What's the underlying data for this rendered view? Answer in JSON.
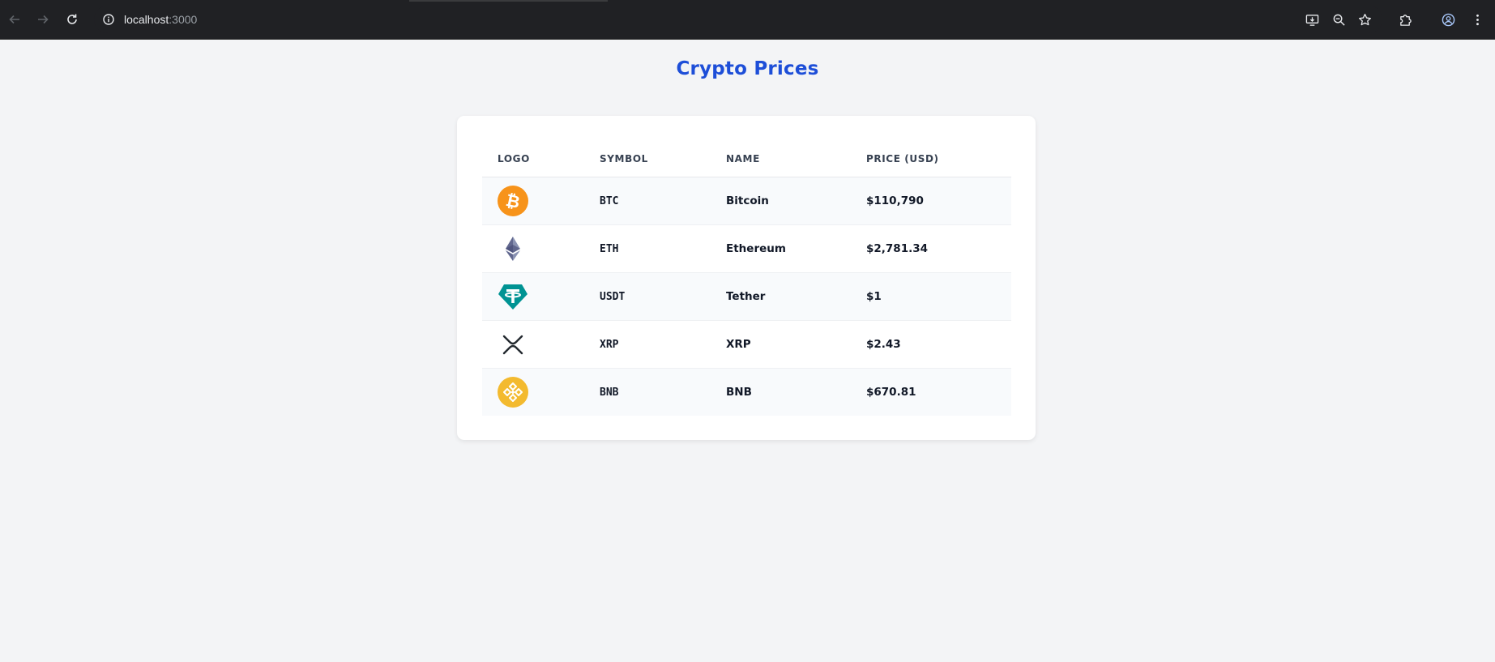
{
  "browser": {
    "url_host": "localhost",
    "url_port": ":3000"
  },
  "page": {
    "title": "Crypto Prices"
  },
  "table": {
    "headers": {
      "logo": "LOGO",
      "symbol": "SYMBOL",
      "name": "NAME",
      "price": "PRICE (USD)"
    },
    "rows": [
      {
        "logo_icon": "bitcoin-icon",
        "symbol": "BTC",
        "name": "Bitcoin",
        "price": "$110,790",
        "color": "#f7931a"
      },
      {
        "logo_icon": "ethereum-icon",
        "symbol": "ETH",
        "name": "Ethereum",
        "price": "$2,781.34",
        "color": "#627eea"
      },
      {
        "logo_icon": "tether-icon",
        "symbol": "USDT",
        "name": "Tether",
        "price": "$1",
        "color": "#26a17b"
      },
      {
        "logo_icon": "xrp-icon",
        "symbol": "XRP",
        "name": "XRP",
        "price": "$2.43",
        "color": "#23292f"
      },
      {
        "logo_icon": "bnb-icon",
        "symbol": "BNB",
        "name": "BNB",
        "price": "$670.81",
        "color": "#f3ba2f"
      }
    ]
  },
  "colors": {
    "title": "#1d4ed8",
    "page_background": "#f3f4f6",
    "chrome_background": "#202124"
  }
}
